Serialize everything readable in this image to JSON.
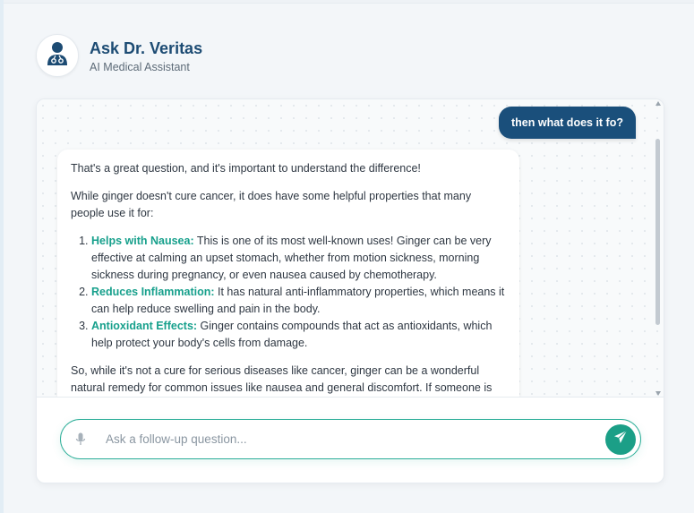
{
  "header": {
    "title": "Ask Dr. Veritas",
    "subtitle": "AI Medical Assistant",
    "avatar_icon": "doctor-icon"
  },
  "messages": {
    "user": "then what does it fo?",
    "bot": {
      "intro": "That's a great question, and it's important to understand the difference!",
      "lead": "While ginger doesn't cure cancer, it does have some helpful properties that many people use it for:",
      "items": [
        {
          "term": "Helps with Nausea:",
          "text": " This is one of its most well-known uses! Ginger can be very effective at calming an upset stomach, whether from motion sickness, morning sickness during pregnancy, or even nausea caused by chemotherapy."
        },
        {
          "term": "Reduces Inflammation:",
          "text": " It has natural anti-inflammatory properties, which means it can help reduce swelling and pain in the body."
        },
        {
          "term": "Antioxidant Effects:",
          "text": " Ginger contains compounds that act as antioxidants, which help protect your body's cells from damage."
        }
      ],
      "closing": "So, while it's not a cure for serious diseases like cancer, ginger can be a wonderful natural remedy for common issues like nausea and general discomfort. If someone is"
    }
  },
  "input": {
    "placeholder": "Ask a follow-up question...",
    "value": "",
    "mic_icon": "microphone-icon",
    "send_icon": "send-icon"
  },
  "colors": {
    "primary": "#1a4f7b",
    "accent": "#1b9f87",
    "term": "#17a08c"
  }
}
